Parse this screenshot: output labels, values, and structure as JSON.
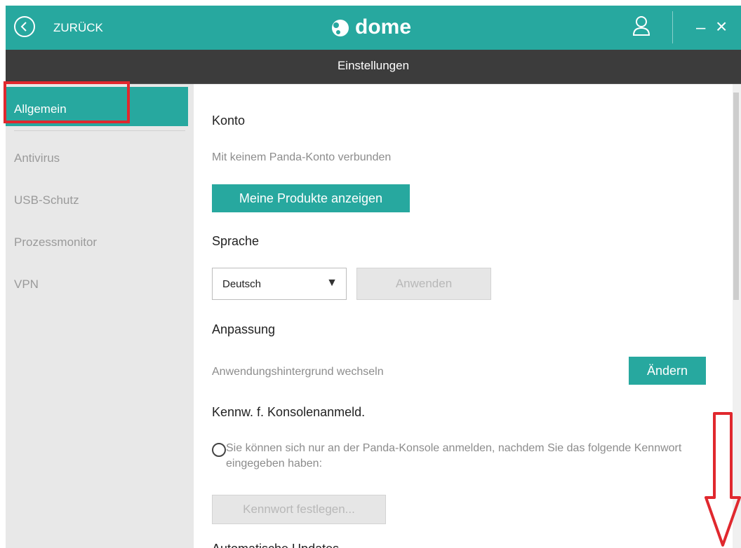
{
  "header": {
    "back_label": "ZURÜCK",
    "logo_text": "dome"
  },
  "subheader": {
    "title": "Einstellungen"
  },
  "sidebar": {
    "items": [
      {
        "label": "Allgemein",
        "active": true
      },
      {
        "label": "Antivirus"
      },
      {
        "label": "USB-Schutz"
      },
      {
        "label": "Prozessmonitor"
      },
      {
        "label": "VPN"
      }
    ]
  },
  "content": {
    "konto": {
      "heading": "Konto",
      "status": "Mit keinem Panda-Konto verbunden",
      "button": "Meine Produkte anzeigen"
    },
    "sprache": {
      "heading": "Sprache",
      "selected": "Deutsch",
      "apply_button": "Anwenden"
    },
    "anpassung": {
      "heading": "Anpassung",
      "label": "Anwendungshintergrund wechseln",
      "button": "Ändern"
    },
    "kennwort": {
      "heading": "Kennw. f. Konsolenanmeld.",
      "radio_text": "Sie können sich nur an der Panda-Konsole anmelden, nachdem Sie das folgende Kennwort eingegeben haben:",
      "button": "Kennwort festlegen..."
    },
    "next_heading": "Automatische Updates"
  },
  "colors": {
    "accent": "#27a89f",
    "header_dark": "#3c3c3c",
    "highlight": "#e0282e"
  }
}
